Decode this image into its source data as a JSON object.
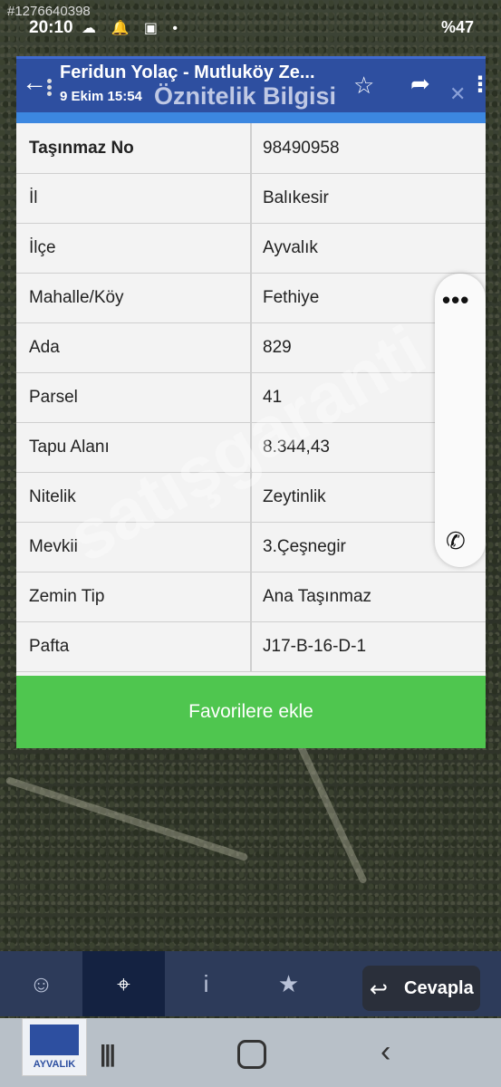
{
  "watermark_id": "#1276640398",
  "status": {
    "time": "20:10",
    "icons": "☁ 🔔 ▣ •",
    "right": "%47"
  },
  "header": {
    "title": "Feridun Yolaç - Mutluköy Ze...",
    "date": "9 Ekim 15:54",
    "subtitle": "Öznitelik Bilgisi"
  },
  "table": [
    {
      "key": "Taşınmaz No",
      "value": "98490958"
    },
    {
      "key": "İl",
      "value": "Balıkesir"
    },
    {
      "key": "İlçe",
      "value": "Ayvalık"
    },
    {
      "key": "Mahalle/Köy",
      "value": "Fethiye"
    },
    {
      "key": "Ada",
      "value": "829"
    },
    {
      "key": "Parsel",
      "value": "41"
    },
    {
      "key": "Tapu Alanı",
      "value": "8.344,43"
    },
    {
      "key": "Nitelik",
      "value": "Zeytinlik"
    },
    {
      "key": "Mevkii",
      "value": "3.Çeşnegir"
    },
    {
      "key": "Zemin Tip",
      "value": "Ana Taşınmaz"
    },
    {
      "key": "Pafta",
      "value": "J17-B-16-D-1"
    }
  ],
  "favorite_label": "Favorilere ekle",
  "watermark_text": "satışgaranti",
  "reply_label": "Cevapla",
  "logo_text": "AYVALIK",
  "colors": {
    "header_bg": "#2e4fa0",
    "favorite_bg": "#4fc64f",
    "accent": "#3c87e0"
  }
}
